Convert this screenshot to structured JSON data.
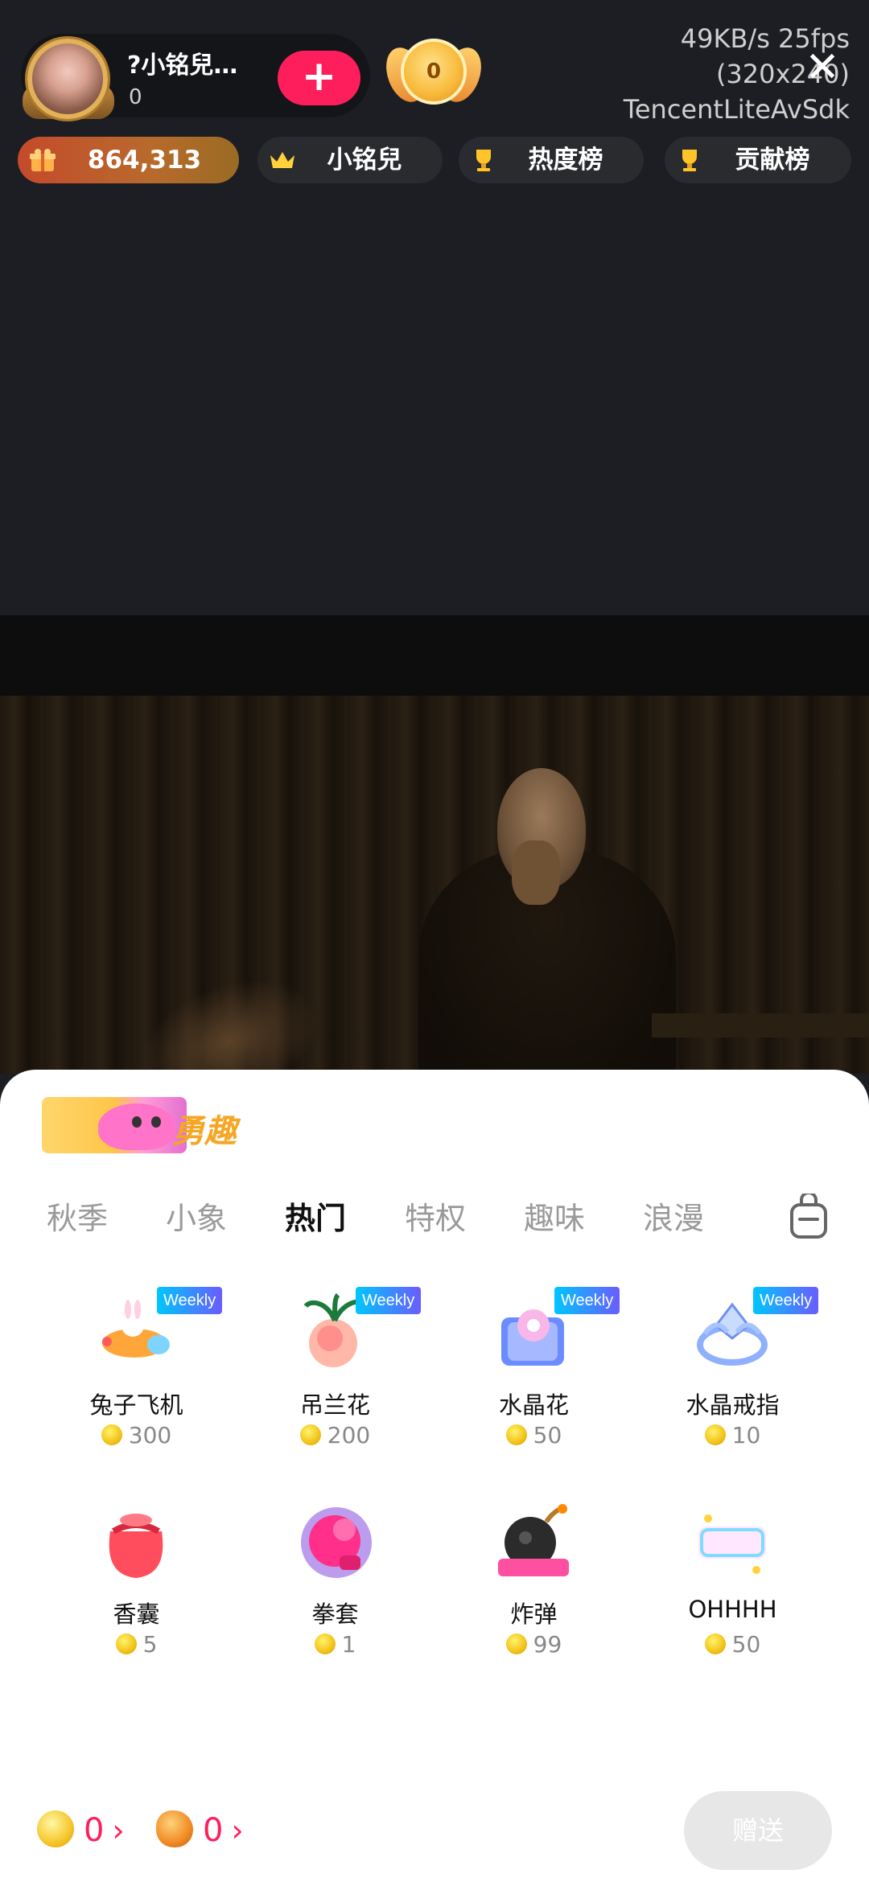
{
  "header": {
    "host_name": "?小铭兒…",
    "host_count": "0",
    "follow_label": "+",
    "medal_value": "0",
    "stats_speed": "49KB/s 25fps",
    "stats_resolution": "(320x240)",
    "stats_sdk": "TencentLiteAvSdk",
    "close_label": "✕"
  },
  "chips": {
    "gift_total": "864,313",
    "host_tag": "小铭兒",
    "hot_rank": "热度榜",
    "contribution_rank": "贡献榜"
  },
  "panel": {
    "banner_text": "勇趣",
    "tabs": [
      "秋季",
      "小象",
      "热门",
      "特权",
      "趣味",
      "浪漫"
    ],
    "active_tab": "热门",
    "weekly_badge": "Weekly",
    "gifts": [
      {
        "name": "兔子飞机",
        "price": "300",
        "weekly": true,
        "icon": "rabbit-plane-icon"
      },
      {
        "name": "吊兰花",
        "price": "200",
        "weekly": true,
        "icon": "flower-icon"
      },
      {
        "name": "水晶花",
        "price": "50",
        "weekly": true,
        "icon": "crystal-flower-icon"
      },
      {
        "name": "水晶戒指",
        "price": "10",
        "weekly": true,
        "icon": "crystal-ring-icon"
      },
      {
        "name": "香囊",
        "price": "5",
        "weekly": false,
        "icon": "sachet-icon"
      },
      {
        "name": "拳套",
        "price": "1",
        "weekly": false,
        "icon": "boxing-glove-icon"
      },
      {
        "name": "炸弹",
        "price": "99",
        "weekly": false,
        "icon": "bomb-icon"
      },
      {
        "name": "OHHHH",
        "price": "50",
        "weekly": false,
        "icon": "ohhh-icon"
      }
    ],
    "page_count": 2,
    "current_page": 1
  },
  "footer": {
    "coin_balance": "0",
    "bean_balance": "0",
    "send_label": "赠送"
  },
  "colors": {
    "accent": "#ff1e5c",
    "gift_chip": "#c44a2b",
    "panel_bg": "#ffffff"
  }
}
